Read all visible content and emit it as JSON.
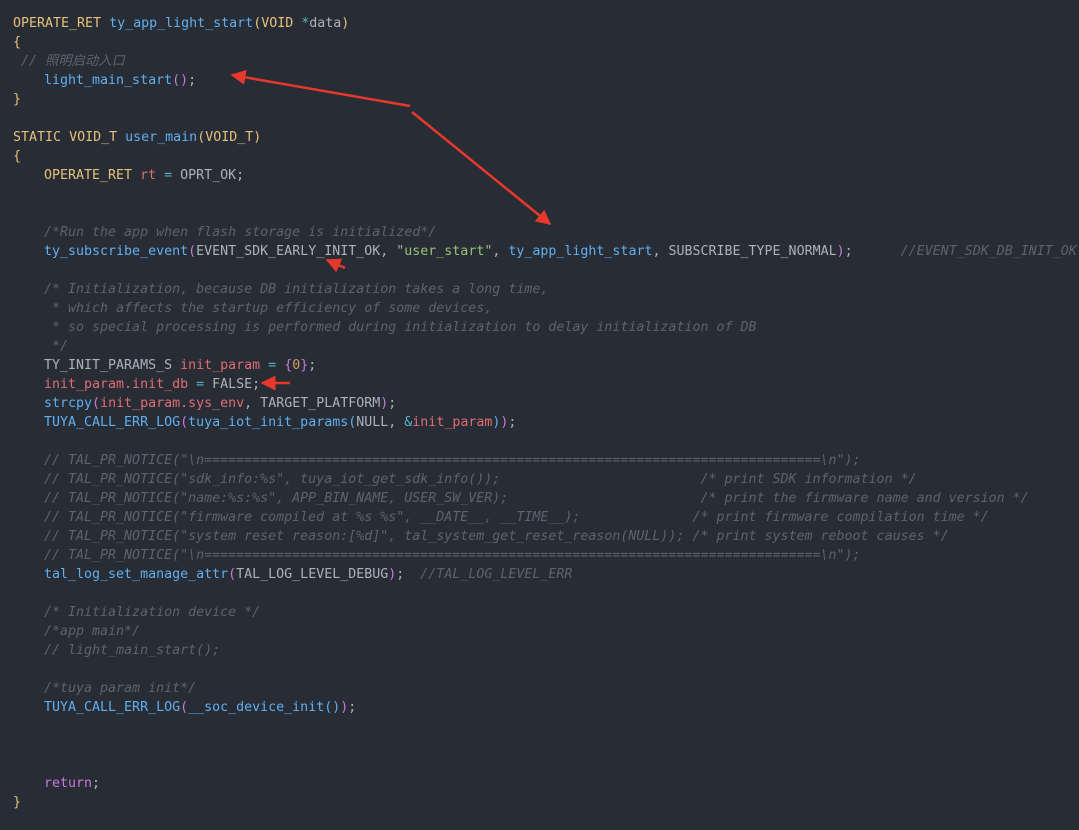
{
  "editor": {
    "theme": {
      "background": "#282c34",
      "annotation_color": "#e8382c"
    },
    "lines": [
      {
        "indent": 0,
        "tokens": [
          {
            "t": "OPERATE_RET",
            "c": "kw"
          },
          {
            "t": " ",
            "c": "pl"
          },
          {
            "t": "ty_app_light_start",
            "c": "fn"
          },
          {
            "t": "(",
            "c": "br"
          },
          {
            "t": "VOID",
            "c": "kw"
          },
          {
            "t": " ",
            "c": "pl"
          },
          {
            "t": "*",
            "c": "op"
          },
          {
            "t": "data",
            "c": "pl"
          },
          {
            "t": ")",
            "c": "br"
          }
        ]
      },
      {
        "indent": 0,
        "tokens": [
          {
            "t": "{",
            "c": "br"
          }
        ]
      },
      {
        "indent": 0,
        "tokens": [
          {
            "t": " // 照明启动入口",
            "c": "cm"
          }
        ]
      },
      {
        "indent": 1,
        "tokens": [
          {
            "t": "light_main_start",
            "c": "fn"
          },
          {
            "t": "()",
            "c": "br2"
          },
          {
            "t": ";",
            "c": "pl"
          }
        ]
      },
      {
        "indent": 0,
        "tokens": [
          {
            "t": "}",
            "c": "br"
          }
        ]
      },
      {
        "indent": 0,
        "tokens": []
      },
      {
        "indent": 0,
        "tokens": [
          {
            "t": "STATIC",
            "c": "kw"
          },
          {
            "t": " ",
            "c": "pl"
          },
          {
            "t": "VOID_T",
            "c": "kw"
          },
          {
            "t": " ",
            "c": "pl"
          },
          {
            "t": "user_main",
            "c": "fn"
          },
          {
            "t": "(",
            "c": "br"
          },
          {
            "t": "VOID_T",
            "c": "kw"
          },
          {
            "t": ")",
            "c": "br"
          }
        ]
      },
      {
        "indent": 0,
        "tokens": [
          {
            "t": "{",
            "c": "br"
          }
        ]
      },
      {
        "indent": 1,
        "tokens": [
          {
            "t": "OPERATE_RET",
            "c": "kw"
          },
          {
            "t": " ",
            "c": "pl"
          },
          {
            "t": "rt",
            "c": "var"
          },
          {
            "t": " ",
            "c": "pl"
          },
          {
            "t": "=",
            "c": "op"
          },
          {
            "t": " OPRT_OK;",
            "c": "pl"
          }
        ]
      },
      {
        "indent": 1,
        "tokens": []
      },
      {
        "indent": 1,
        "tokens": []
      },
      {
        "indent": 1,
        "tokens": [
          {
            "t": "/*Run the app when flash storage is initialized*/",
            "c": "cm"
          }
        ]
      },
      {
        "indent": 1,
        "tokens": [
          {
            "t": "ty_subscribe_event",
            "c": "fn"
          },
          {
            "t": "(",
            "c": "br2"
          },
          {
            "t": "EVENT_SDK_EARLY_INIT_OK, ",
            "c": "pl"
          },
          {
            "t": "\"user_start\"",
            "c": "str"
          },
          {
            "t": ", ",
            "c": "pl"
          },
          {
            "t": "ty_app_light_start",
            "c": "fn"
          },
          {
            "t": ", SUBSCRIBE_TYPE_NORMAL",
            "c": "pl"
          },
          {
            "t": ")",
            "c": "br2"
          },
          {
            "t": ";",
            "c": "pl"
          },
          {
            "t": "      //EVENT_SDK_DB_INIT_OK KV  E",
            "c": "cm"
          }
        ]
      },
      {
        "indent": 1,
        "tokens": []
      },
      {
        "indent": 1,
        "tokens": [
          {
            "t": "/* Initialization, because DB initialization takes a long time,",
            "c": "cm"
          }
        ]
      },
      {
        "indent": 1,
        "tokens": [
          {
            "t": " * which affects the startup efficiency of some devices,",
            "c": "cm"
          }
        ]
      },
      {
        "indent": 1,
        "tokens": [
          {
            "t": " * so special processing is performed during initialization to delay initialization of DB",
            "c": "cm"
          }
        ]
      },
      {
        "indent": 1,
        "tokens": [
          {
            "t": " */",
            "c": "cm"
          }
        ]
      },
      {
        "indent": 1,
        "tokens": [
          {
            "t": "TY_INIT_PARAMS_S ",
            "c": "pl"
          },
          {
            "t": "init_param",
            "c": "var"
          },
          {
            "t": " ",
            "c": "pl"
          },
          {
            "t": "=",
            "c": "op"
          },
          {
            "t": " ",
            "c": "pl"
          },
          {
            "t": "{",
            "c": "br2"
          },
          {
            "t": "0",
            "c": "num"
          },
          {
            "t": "}",
            "c": "br2"
          },
          {
            "t": ";",
            "c": "pl"
          }
        ]
      },
      {
        "indent": 1,
        "tokens": [
          {
            "t": "init_param.init_db",
            "c": "var"
          },
          {
            "t": " ",
            "c": "pl"
          },
          {
            "t": "=",
            "c": "op"
          },
          {
            "t": " FALSE;",
            "c": "pl"
          }
        ]
      },
      {
        "indent": 1,
        "tokens": [
          {
            "t": "strcpy",
            "c": "fn"
          },
          {
            "t": "(",
            "c": "br2"
          },
          {
            "t": "init_param.sys_env",
            "c": "var"
          },
          {
            "t": ", TARGET_PLATFORM",
            "c": "pl"
          },
          {
            "t": ")",
            "c": "br2"
          },
          {
            "t": ";",
            "c": "pl"
          }
        ]
      },
      {
        "indent": 1,
        "tokens": [
          {
            "t": "TUYA_CALL_ERR_LOG",
            "c": "fn"
          },
          {
            "t": "(",
            "c": "br2"
          },
          {
            "t": "tuya_iot_init_params",
            "c": "fn"
          },
          {
            "t": "(",
            "c": "fn"
          },
          {
            "t": "NULL, ",
            "c": "pl"
          },
          {
            "t": "&",
            "c": "op"
          },
          {
            "t": "init_param",
            "c": "var"
          },
          {
            "t": ")",
            "c": "fn"
          },
          {
            "t": ")",
            "c": "br2"
          },
          {
            "t": ";",
            "c": "pl"
          }
        ]
      },
      {
        "indent": 1,
        "tokens": []
      },
      {
        "indent": 1,
        "tokens": [
          {
            "t": "// TAL_PR_NOTICE(\"\\n=============================================================================\\n\");",
            "c": "cm"
          }
        ]
      },
      {
        "indent": 1,
        "tokens": [
          {
            "t": "// TAL_PR_NOTICE(\"sdk_info:%s\", tuya_iot_get_sdk_info());                         /* print SDK information */",
            "c": "cm"
          }
        ]
      },
      {
        "indent": 1,
        "tokens": [
          {
            "t": "// TAL_PR_NOTICE(\"name:%s:%s\", APP_BIN_NAME, USER_SW_VER);                        /* print the firmware name and version */",
            "c": "cm"
          }
        ]
      },
      {
        "indent": 1,
        "tokens": [
          {
            "t": "// TAL_PR_NOTICE(\"firmware compiled at %s %s\", __DATE__, __TIME__);              /* print firmware compilation time */",
            "c": "cm"
          }
        ]
      },
      {
        "indent": 1,
        "tokens": [
          {
            "t": "// TAL_PR_NOTICE(\"system reset reason:[%d]\", tal_system_get_reset_reason(NULL)); /* print system reboot causes */",
            "c": "cm"
          }
        ]
      },
      {
        "indent": 1,
        "tokens": [
          {
            "t": "// TAL_PR_NOTICE(\"\\n=============================================================================\\n\");",
            "c": "cm"
          }
        ]
      },
      {
        "indent": 1,
        "tokens": [
          {
            "t": "tal_log_set_manage_attr",
            "c": "fn"
          },
          {
            "t": "(",
            "c": "br2"
          },
          {
            "t": "TAL_LOG_LEVEL_DEBUG",
            "c": "pl"
          },
          {
            "t": ")",
            "c": "br2"
          },
          {
            "t": ";  ",
            "c": "pl"
          },
          {
            "t": "//TAL_LOG_LEVEL_ERR",
            "c": "cm"
          }
        ]
      },
      {
        "indent": 1,
        "tokens": []
      },
      {
        "indent": 1,
        "tokens": [
          {
            "t": "/* Initialization device */",
            "c": "cm"
          }
        ]
      },
      {
        "indent": 1,
        "tokens": [
          {
            "t": "/*app main*/",
            "c": "cm"
          }
        ]
      },
      {
        "indent": 1,
        "tokens": [
          {
            "t": "// light_main_start();",
            "c": "cm"
          }
        ]
      },
      {
        "indent": 1,
        "tokens": []
      },
      {
        "indent": 1,
        "tokens": [
          {
            "t": "/*tuya param init*/",
            "c": "cm"
          }
        ]
      },
      {
        "indent": 1,
        "tokens": [
          {
            "t": "TUYA_CALL_ERR_LOG",
            "c": "fn"
          },
          {
            "t": "(",
            "c": "br2"
          },
          {
            "t": "__soc_device_init",
            "c": "fn"
          },
          {
            "t": "()",
            "c": "fn"
          },
          {
            "t": ")",
            "c": "br2"
          },
          {
            "t": ";",
            "c": "pl"
          }
        ]
      },
      {
        "indent": 1,
        "tokens": []
      },
      {
        "indent": 1,
        "tokens": []
      },
      {
        "indent": 1,
        "tokens": []
      },
      {
        "indent": 1,
        "tokens": [
          {
            "t": "return",
            "c": "ret"
          },
          {
            "t": ";",
            "c": "pl"
          }
        ]
      },
      {
        "indent": 0,
        "tokens": [
          {
            "t": "}",
            "c": "br"
          }
        ]
      }
    ]
  }
}
